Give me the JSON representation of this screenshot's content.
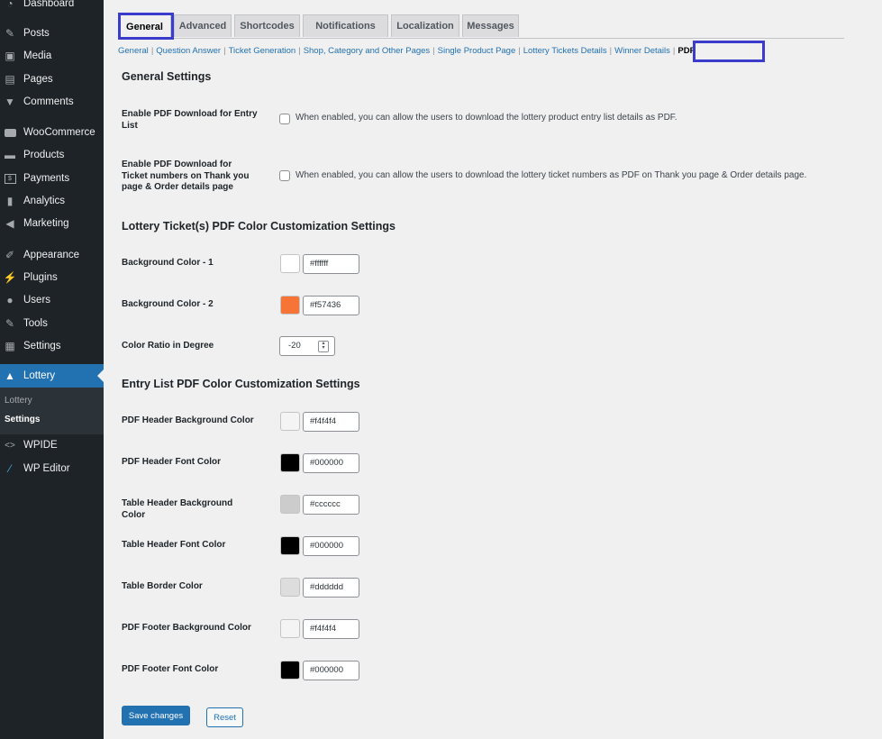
{
  "sidebar": {
    "items": [
      {
        "label": "Dashboard",
        "icon": "dashboard-icon"
      },
      {
        "label": "Posts",
        "icon": "pin-icon"
      },
      {
        "label": "Media",
        "icon": "media-icon"
      },
      {
        "label": "Pages",
        "icon": "pages-icon"
      },
      {
        "label": "Comments",
        "icon": "comments-icon"
      },
      {
        "label": "WooCommerce",
        "icon": "woocommerce-icon"
      },
      {
        "label": "Products",
        "icon": "products-icon"
      },
      {
        "label": "Payments",
        "icon": "payments-icon"
      },
      {
        "label": "Analytics",
        "icon": "analytics-icon"
      },
      {
        "label": "Marketing",
        "icon": "marketing-icon"
      },
      {
        "label": "Appearance",
        "icon": "appearance-icon"
      },
      {
        "label": "Plugins",
        "icon": "plugins-icon"
      },
      {
        "label": "Users",
        "icon": "users-icon"
      },
      {
        "label": "Tools",
        "icon": "tools-icon"
      },
      {
        "label": "Settings",
        "icon": "settings-icon"
      },
      {
        "label": "Lottery",
        "icon": "lottery-icon"
      },
      {
        "label": "WPIDE",
        "icon": "code-icon"
      },
      {
        "label": "WP Editor",
        "icon": "pencil-icon"
      }
    ],
    "submenu": [
      {
        "label": "Lottery"
      },
      {
        "label": "Settings"
      }
    ]
  },
  "tabs": [
    {
      "label": "General"
    },
    {
      "label": "Advanced"
    },
    {
      "label": "Shortcodes"
    },
    {
      "label": "Notifications"
    },
    {
      "label": "Localization"
    },
    {
      "label": "Messages"
    }
  ],
  "subsections": [
    {
      "label": "General"
    },
    {
      "label": "Question Answer"
    },
    {
      "label": "Ticket Generation"
    },
    {
      "label": "Shop, Category and Other Pages"
    },
    {
      "label": "Single Product Page"
    },
    {
      "label": "Lottery Tickets Details"
    },
    {
      "label": "Winner Details"
    },
    {
      "label": "PDF"
    }
  ],
  "sections": {
    "general": "General Settings",
    "ticket_pdf": "Lottery Ticket(s) PDF Color Customization Settings",
    "entry_pdf": "Entry List PDF Color Customization Settings"
  },
  "checkbox_fields": [
    {
      "label": "Enable PDF Download for Entry List",
      "description": "When enabled, you can allow the users to download the lottery product entry list details as PDF.",
      "checked": false
    },
    {
      "label": "Enable PDF Download for Ticket numbers on Thank you page & Order details page",
      "description": "When enabled, you can allow the users to download the lottery ticket numbers as PDF on Thank you page & Order details page.",
      "checked": false
    }
  ],
  "ticket_colors": [
    {
      "label": "Background Color - 1",
      "value": "#ffffff"
    },
    {
      "label": "Background Color - 2",
      "value": "#f57436"
    }
  ],
  "color_ratio": {
    "label": "Color Ratio in Degree",
    "value": "-20"
  },
  "entry_colors": [
    {
      "label": "PDF Header Background Color",
      "value": "#f4f4f4"
    },
    {
      "label": "PDF Header Font Color",
      "value": "#000000"
    },
    {
      "label": "Table Header Background Color",
      "value": "#cccccc"
    },
    {
      "label": "Table Header Font Color",
      "value": "#000000"
    },
    {
      "label": "Table Border Color",
      "value": "#dddddd"
    },
    {
      "label": "PDF Footer Background Color",
      "value": "#f4f4f4"
    },
    {
      "label": "PDF Footer Font Color",
      "value": "#000000"
    }
  ],
  "buttons": {
    "save": "Save changes",
    "reset": "Reset"
  },
  "theme": {
    "sidebar_bg": "#1d2327",
    "accent": "#2271b1",
    "highlight": "#3b3bcc"
  }
}
